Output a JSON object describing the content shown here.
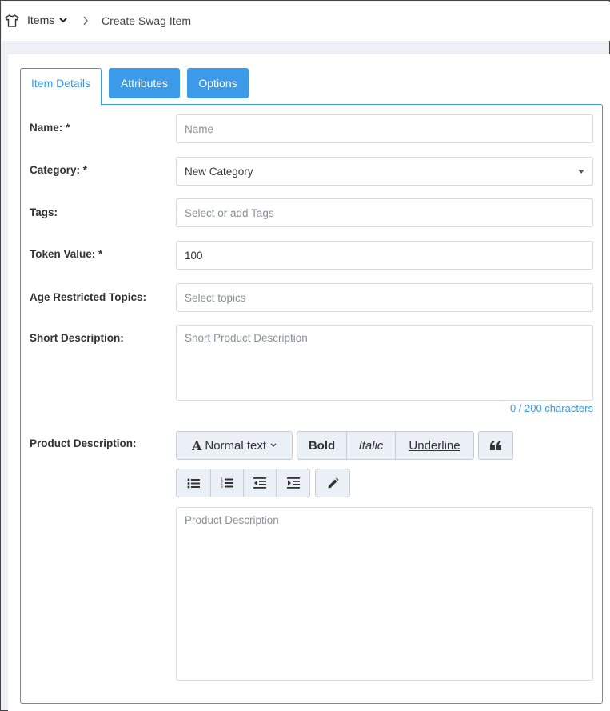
{
  "breadcrumb": {
    "items_label": "Items",
    "current": "Create Swag Item"
  },
  "tabs": {
    "details": "Item Details",
    "attributes": "Attributes",
    "options": "Options"
  },
  "form": {
    "name_label": "Name: *",
    "name_placeholder": "Name",
    "category_label": "Category: *",
    "category_value": "New Category",
    "tags_label": "Tags:",
    "tags_placeholder": "Select or add Tags",
    "token_label": "Token Value: *",
    "token_value": "100",
    "age_label": "Age Restricted Topics:",
    "age_placeholder": "Select topics",
    "short_desc_label": "Short Description:",
    "short_desc_placeholder": "Short Product Description",
    "short_desc_counter": "0 / 200 characters",
    "product_desc_label": "Product Description:",
    "product_desc_placeholder": "Product Description"
  },
  "toolbar": {
    "text_style": "Normal text",
    "bold": "Bold",
    "italic": "Italic",
    "underline": "Underline"
  },
  "colors": {
    "accent": "#3d9ae8"
  }
}
